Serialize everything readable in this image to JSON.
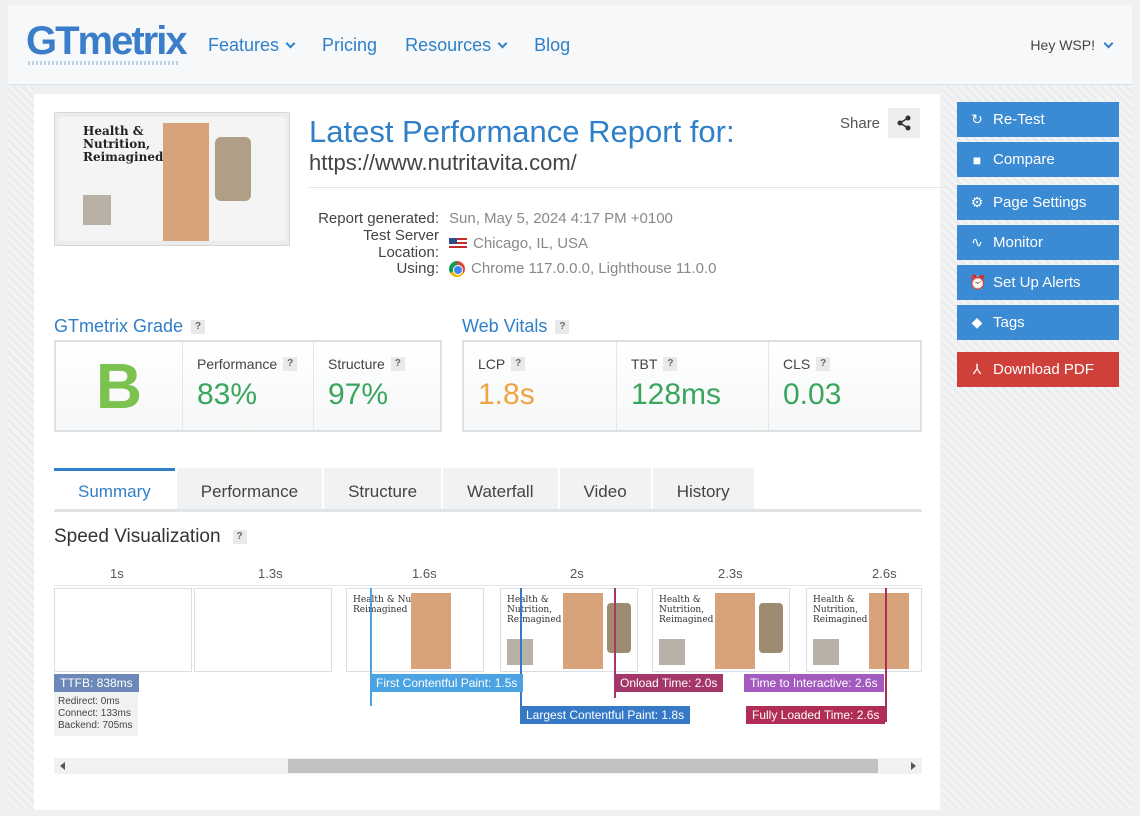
{
  "header": {
    "logo": "GTmetrix",
    "nav": [
      {
        "label": "Features",
        "dropdown": true
      },
      {
        "label": "Pricing",
        "dropdown": false
      },
      {
        "label": "Resources",
        "dropdown": true
      },
      {
        "label": "Blog",
        "dropdown": false
      }
    ],
    "user_label": "Hey WSP!"
  },
  "thumbnail": {
    "line1": "Health &",
    "line2": "Nutrition,",
    "line3": "Reimagined"
  },
  "share_label": "Share",
  "report": {
    "title": "Latest Performance Report for:",
    "url": "https://www.nutritavita.com/",
    "generated_label": "Report generated:",
    "generated_value": "Sun, May 5, 2024 4:17 PM +0100",
    "location_label": "Test Server Location:",
    "location_value": "Chicago, IL, USA",
    "using_label": "Using:",
    "using_value": "Chrome 117.0.0.0, Lighthouse 11.0.0"
  },
  "grade": {
    "section_title": "GTmetrix Grade",
    "letter": "B",
    "performance_label": "Performance",
    "performance_value": "83%",
    "structure_label": "Structure",
    "structure_value": "97%"
  },
  "vitals": {
    "section_title": "Web Vitals",
    "lcp_label": "LCP",
    "lcp_value": "1.8s",
    "tbt_label": "TBT",
    "tbt_value": "128ms",
    "cls_label": "CLS",
    "cls_value": "0.03"
  },
  "tabs": [
    "Summary",
    "Performance",
    "Structure",
    "Waterfall",
    "Video",
    "History"
  ],
  "speed": {
    "title": "Speed Visualization",
    "timeline": [
      "1s",
      "1.3s",
      "1.6s",
      "2s",
      "2.3s",
      "2.6s"
    ],
    "ttfb": "TTFB: 838ms",
    "redirect": "Redirect: 0ms",
    "connect": "Connect: 133ms",
    "backend": "Backend: 705ms",
    "fcp": "First Contentful Paint: 1.5s",
    "lcp": "Largest Contentful Paint: 1.8s",
    "onload": "Onload Time: 2.0s",
    "tti": "Time to Interactive: 2.6s",
    "fully": "Fully Loaded Time: 2.6s"
  },
  "sidebar": {
    "retest": "Re-Test",
    "compare": "Compare",
    "page_settings": "Page Settings",
    "monitor": "Monitor",
    "alerts": "Set Up Alerts",
    "tags": "Tags",
    "download": "Download PDF"
  },
  "colors": {
    "brand": "#2f80c8",
    "grade_green": "#7cc24e",
    "lcp_orange": "#f0a445",
    "good_green": "#3aa55d",
    "fcp_blue": "#4ba3e3",
    "lcp_blue": "#3679c6",
    "onload": "#a5366a",
    "tti": "#a35bc0",
    "fully": "#b02d55",
    "pdf_red": "#d0403a"
  }
}
